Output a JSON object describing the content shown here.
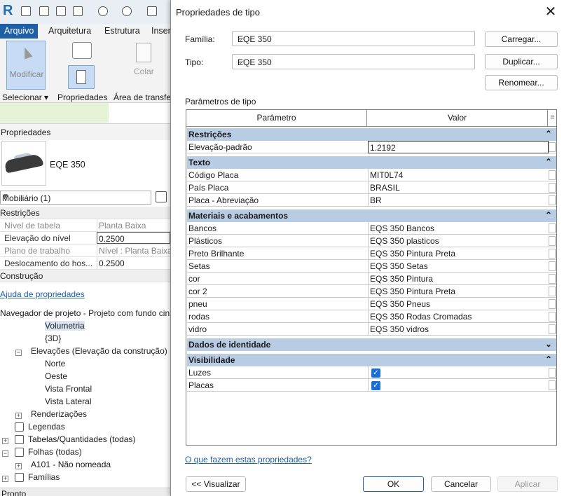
{
  "app": {
    "logo": "R"
  },
  "ribbon": {
    "tabs": [
      "Arquivo",
      "Arquitetura",
      "Estrutura",
      "Inseri"
    ],
    "modificar": "Modificar",
    "colar": "Colar",
    "selecionar": "Selecionar ▾",
    "propriedades": "Propriedades",
    "area": "Área de transfe"
  },
  "props": {
    "header": "Propriedades",
    "family_name": "EQE 350",
    "type_selector": "Mobiliário (1)",
    "rows": [
      {
        "k": "Restrições",
        "v": "",
        "sec": true
      },
      {
        "k": "Nível de tabela",
        "v": "Planta Baixa",
        "gray": true
      },
      {
        "k": "Elevação do nível",
        "v": "0.2500"
      },
      {
        "k": "Plano de trabalho",
        "v": "Nível : Planta Baixa",
        "gray": true
      },
      {
        "k": "Deslocamento do hos...",
        "v": "0.2500"
      },
      {
        "k": "Construção",
        "v": "",
        "sec": true
      }
    ],
    "help": "Ajuda de propriedades"
  },
  "nav": {
    "header": "Navegador de projeto - Projeto com fundo cin",
    "items": [
      "Volumetria",
      "{3D}",
      "Elevações (Elevação da construção)",
      "Norte",
      "Oeste",
      "Vista Frontal",
      "Vista Lateral",
      "Renderizações",
      "Legendas",
      "Tabelas/Quantidades (todas)",
      "Folhas (todas)",
      "A101 - Não nomeada",
      "Famílias"
    ],
    "bottom": "Pronto"
  },
  "dialog": {
    "title": "Propriedades de tipo",
    "familia_label": "Família:",
    "familia_value": "EQE 350",
    "tipo_label": "Tipo:",
    "tipo_value": "EQE 350",
    "carregar": "Carregar...",
    "duplicar": "Duplicar...",
    "renomear": "Renomear...",
    "params_label": "Parâmetros de tipo",
    "col_param": "Parâmetro",
    "col_valor": "Valor",
    "col_eq": "=",
    "sections": [
      {
        "title": "Restrições",
        "rows": [
          {
            "p": "Elevação-padrão",
            "v": "1.2192"
          }
        ]
      },
      {
        "title": "Texto",
        "rows": [
          {
            "p": "Código Placa",
            "v": "MIT0L74"
          },
          {
            "p": "País Placa",
            "v": "BRASIL"
          },
          {
            "p": "Placa - Abreviação",
            "v": "BR"
          }
        ]
      },
      {
        "title": "Materiais e acabamentos",
        "rows": [
          {
            "p": "Bancos",
            "v": "EQS 350 Bancos"
          },
          {
            "p": "Plásticos",
            "v": "EQS 350 plasticos"
          },
          {
            "p": "Preto Brilhante",
            "v": "EQS 350 Pintura Preta"
          },
          {
            "p": "Setas",
            "v": "EQS 350 Setas"
          },
          {
            "p": "cor",
            "v": "EQS 350 Pintura"
          },
          {
            "p": "cor 2",
            "v": "EQS 350 Pintura Preta"
          },
          {
            "p": "pneu",
            "v": "EQS 350 Pneus"
          },
          {
            "p": "rodas",
            "v": "EQS 350 Rodas Cromadas"
          },
          {
            "p": "vidro",
            "v": "EQS 350 vidros"
          }
        ]
      },
      {
        "title": "Dados de identidade",
        "rows": []
      },
      {
        "title": "Visibilidade",
        "rows": [
          {
            "p": "Luzes",
            "check": true
          },
          {
            "p": "Placas",
            "check": true
          }
        ]
      }
    ],
    "help_link": "O que fazem estas propriedades?",
    "visualizar": "<< Visualizar",
    "ok": "OK",
    "cancelar": "Cancelar",
    "aplicar": "Aplicar",
    "accent": "#1f5fa5",
    "section_bg": "#b8cce4"
  }
}
